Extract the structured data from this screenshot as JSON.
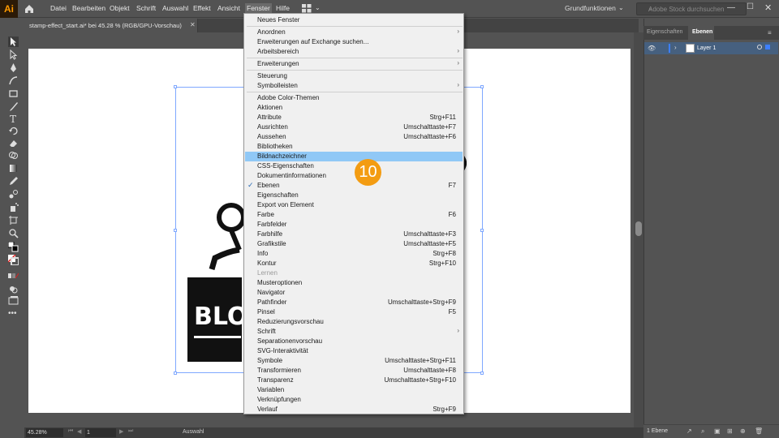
{
  "app": {
    "logo": "Ai"
  },
  "menubar": {
    "items": [
      "Datei",
      "Bearbeiten",
      "Objekt",
      "Schrift",
      "Auswahl",
      "Effekt",
      "Ansicht",
      "Fenster",
      "Hilfe"
    ],
    "workspace": "Grundfunktionen",
    "search_placeholder": "Adobe Stock durchsuchen"
  },
  "document": {
    "tab_label": "stamp-effect_start.ai* bei 45.28 % (RGB/GPU-Vorschau)"
  },
  "canvas": {
    "art_text": "BLO"
  },
  "panel": {
    "tabs": [
      "Eigenschaften",
      "Ebenen"
    ],
    "active_tab": "Ebenen",
    "layers": [
      {
        "name": "Layer 1",
        "visible": true,
        "color": "#3d7fff"
      }
    ],
    "layer_count": "1 Ebene"
  },
  "statusbar": {
    "zoom": "45.28%",
    "page": "1",
    "tool": "Auswahl"
  },
  "fenster_menu": {
    "items": [
      {
        "label": "Neues Fenster"
      },
      {
        "sep": true
      },
      {
        "label": "Anordnen",
        "submenu": true
      },
      {
        "label": "Erweiterungen auf Exchange suchen..."
      },
      {
        "label": "Arbeitsbereich",
        "submenu": true
      },
      {
        "sep": true
      },
      {
        "label": "Erweiterungen",
        "submenu": true
      },
      {
        "sep": true
      },
      {
        "label": "Steuerung"
      },
      {
        "label": "Symbolleisten",
        "submenu": true
      },
      {
        "sep": true
      },
      {
        "label": "Adobe Color-Themen"
      },
      {
        "label": "Aktionen"
      },
      {
        "label": "Attribute",
        "shortcut": "Strg+F11"
      },
      {
        "label": "Ausrichten",
        "shortcut": "Umschalttaste+F7"
      },
      {
        "label": "Aussehen",
        "shortcut": "Umschalttaste+F6"
      },
      {
        "label": "Bibliotheken"
      },
      {
        "label": "Bildnachzeichner",
        "highlighted": true
      },
      {
        "label": "CSS-Eigenschaften"
      },
      {
        "label": "Dokumentinformationen"
      },
      {
        "label": "Ebenen",
        "shortcut": "F7",
        "checked": true
      },
      {
        "label": "Eigenschaften"
      },
      {
        "label": "Export von Element"
      },
      {
        "label": "Farbe",
        "shortcut": "F6"
      },
      {
        "label": "Farbfelder"
      },
      {
        "label": "Farbhilfe",
        "shortcut": "Umschalttaste+F3"
      },
      {
        "label": "Grafikstile",
        "shortcut": "Umschalttaste+F5"
      },
      {
        "label": "Info",
        "shortcut": "Strg+F8"
      },
      {
        "label": "Kontur",
        "shortcut": "Strg+F10"
      },
      {
        "label": "Lernen",
        "disabled": true
      },
      {
        "label": "Musteroptionen"
      },
      {
        "label": "Navigator"
      },
      {
        "label": "Pathfinder",
        "shortcut": "Umschalttaste+Strg+F9"
      },
      {
        "label": "Pinsel",
        "shortcut": "F5"
      },
      {
        "label": "Reduzierungsvorschau"
      },
      {
        "label": "Schrift",
        "submenu": true
      },
      {
        "label": "Separationenvorschau"
      },
      {
        "label": "SVG-Interaktivität"
      },
      {
        "label": "Symbole",
        "shortcut": "Umschalttaste+Strg+F11"
      },
      {
        "label": "Transformieren",
        "shortcut": "Umschalttaste+F8"
      },
      {
        "label": "Transparenz",
        "shortcut": "Umschalttaste+Strg+F10"
      },
      {
        "label": "Variablen"
      },
      {
        "label": "Verknüpfungen"
      },
      {
        "label": "Verlauf",
        "shortcut": "Strg+F9"
      }
    ]
  },
  "step_badge": "10",
  "colors": {
    "accent": "#f39c12",
    "highlight": "#90c8f6",
    "selection": "#7fa8ff"
  }
}
